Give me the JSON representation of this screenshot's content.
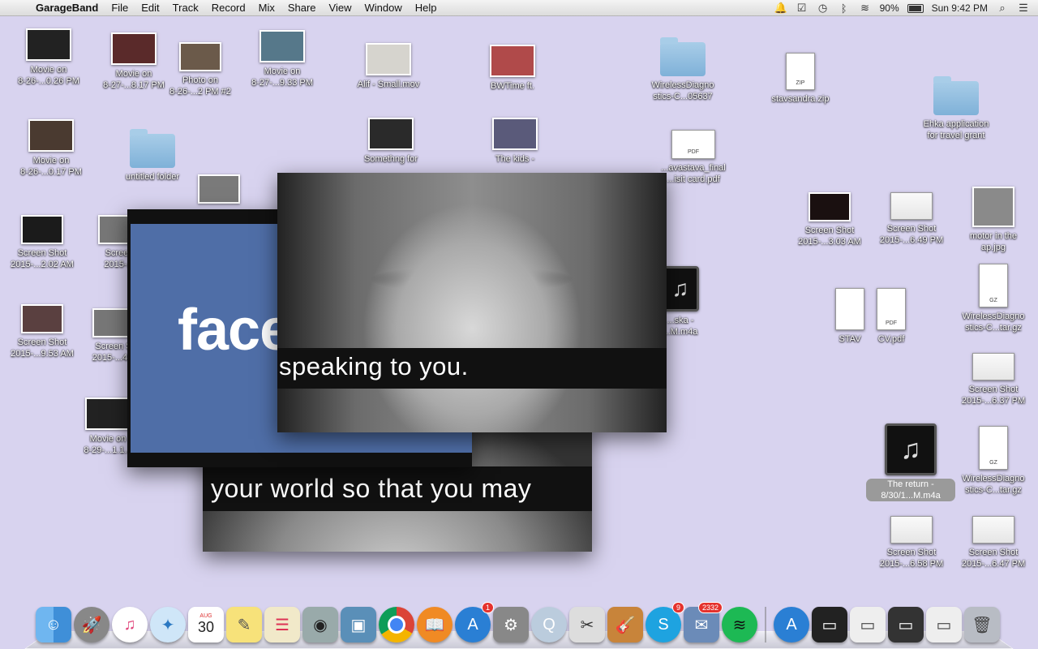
{
  "menubar": {
    "app_name": "GarageBand",
    "items": [
      "File",
      "Edit",
      "Track",
      "Record",
      "Mix",
      "Share",
      "View",
      "Window",
      "Help"
    ],
    "battery": "90%",
    "clock": "Sun 9:42 PM"
  },
  "desktop": {
    "icons": [
      {
        "l1": "Movie on",
        "l2": "8-26-...0.26 PM"
      },
      {
        "l1": "Movie on",
        "l2": "8-27-...8.17 PM"
      },
      {
        "l1": "Photo on",
        "l2": "8-26-...2 PM #2"
      },
      {
        "l1": "Movie on",
        "l2": "8-27-...9.33 PM"
      },
      {
        "l1": "Alif - Small.mov",
        "l2": ""
      },
      {
        "l1": "BWTime ft.",
        "l2": ""
      },
      {
        "l1": "WirelessDiagno",
        "l2": "stics-C...05637"
      },
      {
        "l1": "stavsandra.zip",
        "l2": ""
      },
      {
        "l1": "Ehka application",
        "l2": "for travel grant"
      },
      {
        "l1": "Movie on",
        "l2": "8-26-...0.17 PM"
      },
      {
        "l1": "untitled folder",
        "l2": ""
      },
      {
        "l1": "Somethng for",
        "l2": ""
      },
      {
        "l1": "The kids -",
        "l2": ""
      },
      {
        "l1": "...avastava_final",
        "l2": "...isit card.pdf"
      },
      {
        "l1": "Screen Shot",
        "l2": "2015-...2.02 AM"
      },
      {
        "l1": "Screen",
        "l2": "2015-..."
      },
      {
        "l1": "Screen Shot",
        "l2": "2015-...3.03 AM"
      },
      {
        "l1": "Screen Shot",
        "l2": "2015-...6.49 PM"
      },
      {
        "l1": "motor in the",
        "l2": "ap.jpg"
      },
      {
        "l1": "...ska -",
        "l2": "...M.m4a"
      },
      {
        "l1": "STAV",
        "l2": ""
      },
      {
        "l1": "CV.pdf",
        "l2": ""
      },
      {
        "l1": "WirelessDiagno",
        "l2": "stics-C...tar.gz"
      },
      {
        "l1": "Screen Shot",
        "l2": "2015-...9.53 AM"
      },
      {
        "l1": "Screen S",
        "l2": "2015-...4..."
      },
      {
        "l1": "Screen Shot",
        "l2": "2015-...6.37 PM"
      },
      {
        "l1": "Movie on",
        "l2": "8-29-...1.1..."
      },
      {
        "l1": "The return -",
        "l2": "8/30/1...M.m4a"
      },
      {
        "l1": "WirelessDiagno",
        "l2": "stics-C...tar.gz"
      },
      {
        "l1": "Screen Shot",
        "l2": "2015-...6.58 PM"
      },
      {
        "l1": "Screen Shot",
        "l2": "2015-...6.47 PM"
      }
    ]
  },
  "windows": {
    "face_subtitle": "speaking to you.",
    "back_subtitle": "your world so that you may",
    "fb_text": "face"
  },
  "dock": {
    "calendar_day": "30",
    "calendar_month": "AUG",
    "badge_appstore": "1",
    "badge_skype": "9",
    "badge_mail": "2332"
  }
}
